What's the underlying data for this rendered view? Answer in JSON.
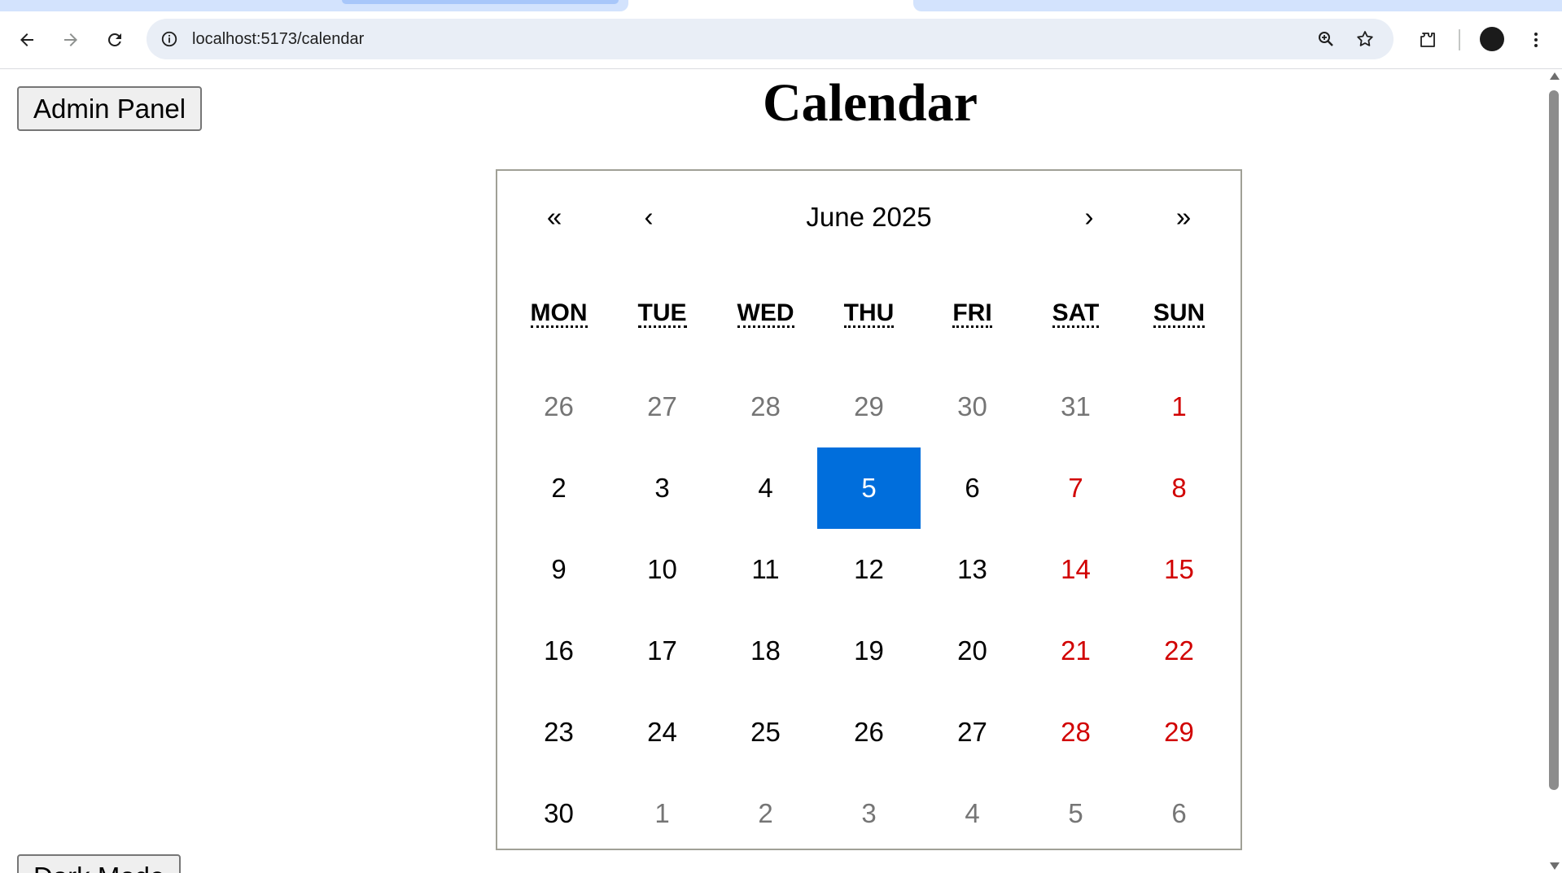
{
  "browser": {
    "url": "localhost:5173/calendar"
  },
  "page": {
    "admin_button": "Admin Panel",
    "title": "Calendar",
    "dark_mode_button": "Dark Mode"
  },
  "calendar": {
    "month_label": "June 2025",
    "nav": {
      "prev_year": "«",
      "prev_month": "‹",
      "next_month": "›",
      "next_year": "»"
    },
    "weekdays": [
      "MON",
      "TUE",
      "WED",
      "THU",
      "FRI",
      "SAT",
      "SUN"
    ],
    "days": [
      {
        "label": "26",
        "state": "neighbor"
      },
      {
        "label": "27",
        "state": "neighbor"
      },
      {
        "label": "28",
        "state": "neighbor"
      },
      {
        "label": "29",
        "state": "neighbor"
      },
      {
        "label": "30",
        "state": "neighbor"
      },
      {
        "label": "31",
        "state": "neighbor"
      },
      {
        "label": "1",
        "state": "weekend"
      },
      {
        "label": "2",
        "state": "normal"
      },
      {
        "label": "3",
        "state": "normal"
      },
      {
        "label": "4",
        "state": "normal"
      },
      {
        "label": "5",
        "state": "today"
      },
      {
        "label": "6",
        "state": "normal"
      },
      {
        "label": "7",
        "state": "weekend"
      },
      {
        "label": "8",
        "state": "weekend"
      },
      {
        "label": "9",
        "state": "normal"
      },
      {
        "label": "10",
        "state": "normal"
      },
      {
        "label": "11",
        "state": "normal"
      },
      {
        "label": "12",
        "state": "normal"
      },
      {
        "label": "13",
        "state": "normal"
      },
      {
        "label": "14",
        "state": "weekend"
      },
      {
        "label": "15",
        "state": "weekend"
      },
      {
        "label": "16",
        "state": "normal"
      },
      {
        "label": "17",
        "state": "normal"
      },
      {
        "label": "18",
        "state": "normal"
      },
      {
        "label": "19",
        "state": "normal"
      },
      {
        "label": "20",
        "state": "normal"
      },
      {
        "label": "21",
        "state": "weekend"
      },
      {
        "label": "22",
        "state": "weekend"
      },
      {
        "label": "23",
        "state": "normal"
      },
      {
        "label": "24",
        "state": "normal"
      },
      {
        "label": "25",
        "state": "normal"
      },
      {
        "label": "26",
        "state": "normal"
      },
      {
        "label": "27",
        "state": "normal"
      },
      {
        "label": "28",
        "state": "weekend"
      },
      {
        "label": "29",
        "state": "weekend"
      },
      {
        "label": "30",
        "state": "normal"
      },
      {
        "label": "1",
        "state": "neighbor"
      },
      {
        "label": "2",
        "state": "neighbor"
      },
      {
        "label": "3",
        "state": "neighbor"
      },
      {
        "label": "4",
        "state": "neighbor"
      },
      {
        "label": "5",
        "state": "neighbor"
      },
      {
        "label": "6",
        "state": "neighbor"
      }
    ]
  },
  "colors": {
    "today_bg": "#006edc",
    "weekend_text": "#d10000",
    "neighbor_text": "#757575"
  },
  "icons": [
    "back-arrow-icon",
    "forward-arrow-icon",
    "reload-icon",
    "site-info-icon",
    "zoom-icon",
    "bookmark-star-icon",
    "extensions-icon",
    "profile-avatar",
    "more-menu-icon"
  ]
}
